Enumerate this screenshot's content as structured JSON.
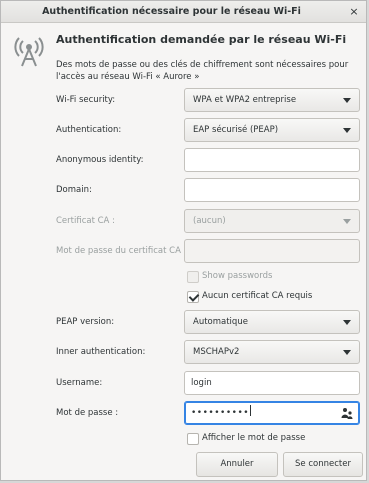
{
  "window": {
    "title": "Authentification nécessaire pour le réseau Wi-Fi",
    "close_glyph": "×"
  },
  "header": {
    "icon": "wifi-antenna-icon",
    "heading": "Authentification demandée par le réseau Wi-Fi",
    "description": "Des mots de passe ou des clés de chiffrement sont nécessaires pour l'accès au réseau Wi-Fi « Aurore »"
  },
  "form": {
    "wifi_security": {
      "label": "Wi-Fi security:",
      "value": "WPA et WPA2 entreprise"
    },
    "authentication": {
      "label": "Authentication:",
      "value": "EAP sécurisé (PEAP)"
    },
    "anonymous_identity": {
      "label": "Anonymous identity:",
      "value": ""
    },
    "domain": {
      "label": "Domain:",
      "value": ""
    },
    "ca_certificate": {
      "label": "Certificat CA :",
      "value": "(aucun)"
    },
    "ca_cert_password": {
      "label": "Mot de passe du certificat CA :",
      "value": ""
    },
    "show_passwords": {
      "label": "Show passwords",
      "checked": false
    },
    "no_ca_required": {
      "label": "Aucun certificat CA requis",
      "checked": true
    },
    "peap_version": {
      "label": "PEAP version:",
      "value": "Automatique"
    },
    "inner_authentication": {
      "label": "Inner authentication:",
      "value": "MSCHAPv2"
    },
    "username": {
      "label": "Username:",
      "value": "login"
    },
    "password": {
      "label": "Mot de passe :",
      "value": "••••••••••"
    },
    "show_password": {
      "label": "Afficher le mot de passe",
      "checked": false
    }
  },
  "buttons": {
    "cancel": "Annuler",
    "connect": "Se connecter"
  },
  "colors": {
    "focus_accent": "#3584e4",
    "dialog_bg": "#f6f5f4"
  }
}
